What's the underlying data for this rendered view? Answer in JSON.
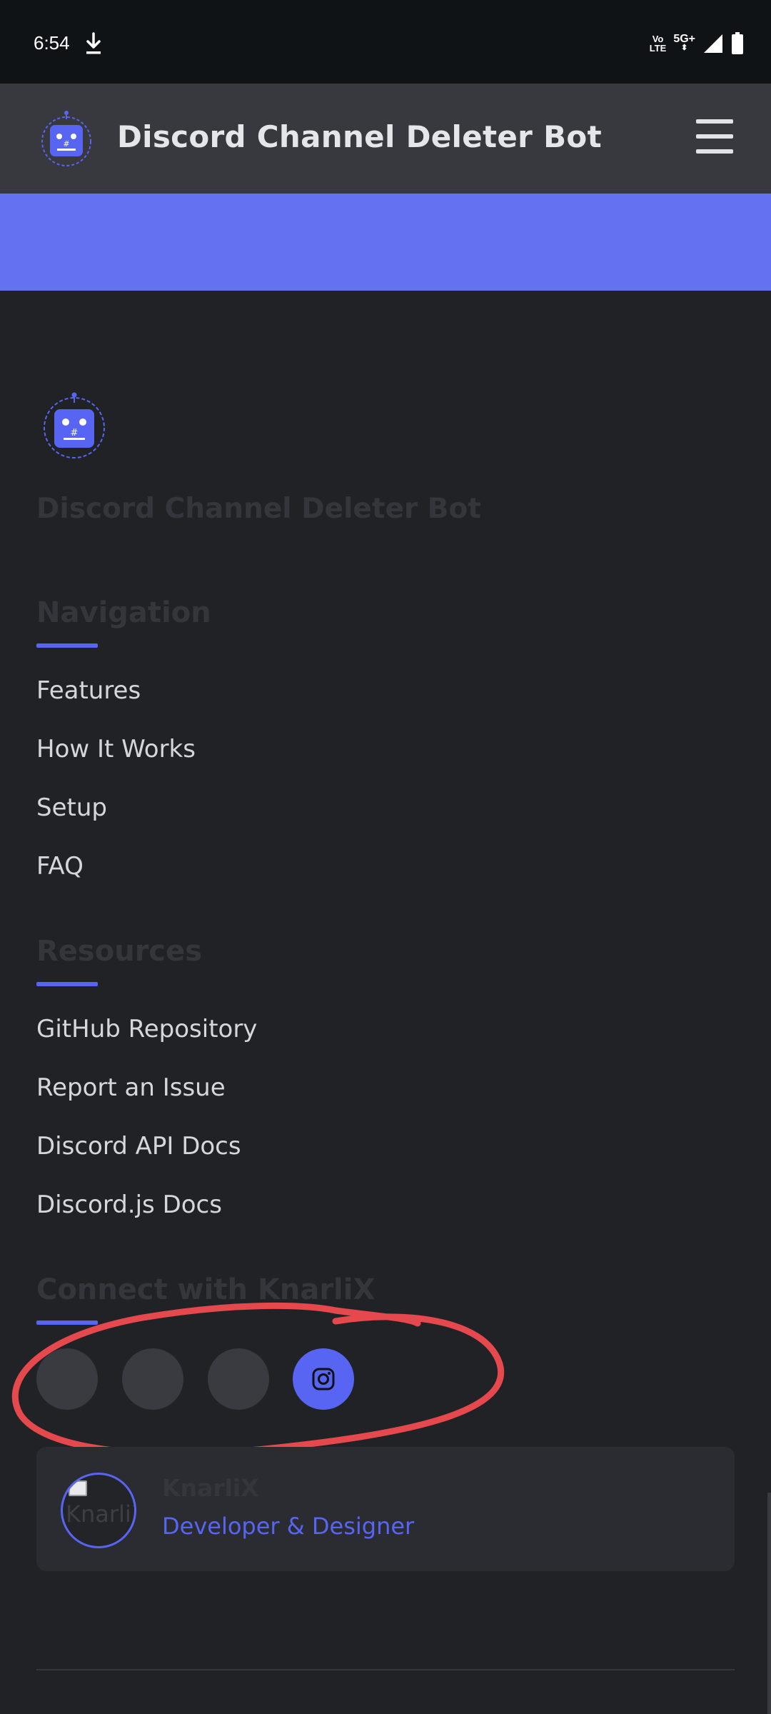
{
  "status_bar": {
    "time": "6:54",
    "icons": [
      "download-icon",
      "volte-icon",
      "5g-plus-icon",
      "signal-icon",
      "battery-icon"
    ],
    "volte_top": "Vo",
    "volte_bottom": "LTE",
    "network": "5G+"
  },
  "header": {
    "title": "Discord Channel Deleter Bot",
    "logo_icon": "robot-logo-icon",
    "menu_icon": "hamburger-menu-icon"
  },
  "colors": {
    "accent": "#5865f2",
    "band": "#6471f0",
    "background": "#212226",
    "header": "#37393f",
    "annotation": "#e5484d"
  },
  "footer": {
    "brand": "Discord Channel Deleter Bot",
    "navigation": {
      "title": "Navigation",
      "links": [
        "Features",
        "How It Works",
        "Setup",
        "FAQ"
      ]
    },
    "resources": {
      "title": "Resources",
      "links": [
        "GitHub Repository",
        "Report an Issue",
        "Discord API Docs",
        "Discord.js Docs"
      ]
    },
    "connect": {
      "title": "Connect with KnarliX",
      "social_icons": [
        "social-icon-1",
        "social-icon-2",
        "social-icon-3",
        "instagram-icon"
      ]
    },
    "developer": {
      "image_alt": "KnarliX",
      "name": "KnarliX",
      "role": "Developer & Designer"
    }
  }
}
